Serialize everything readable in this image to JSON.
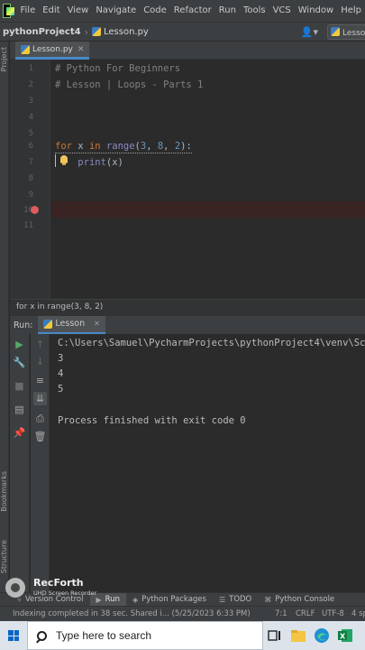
{
  "menubar": {
    "items": [
      "File",
      "Edit",
      "View",
      "Navigate",
      "Code",
      "Refactor",
      "Run",
      "Tools",
      "VCS",
      "Window",
      "Help"
    ]
  },
  "navbar": {
    "project": "pythonProject4",
    "file": "Lesson.py",
    "user_icon": "user-icon",
    "run_config": "Lesso"
  },
  "left_strip": {
    "project_label": "Project",
    "bookmarks_label": "Bookmarks",
    "structure_label": "Structure"
  },
  "editor": {
    "tab": "Lesson.py",
    "line_numbers": [
      "1",
      "2",
      "3",
      "4",
      "5",
      "6",
      "7",
      "8",
      "9",
      "10",
      "11"
    ],
    "line1": "# Python For Beginners",
    "line2": "# Lesson | Loops - Parts 1",
    "line6": {
      "kw_for": "for",
      "var": " x ",
      "kw_in": "in",
      "space": " ",
      "builtin": "range",
      "open": "(",
      "n1": "3",
      "c1": ", ",
      "n2": "8",
      "c2": ", ",
      "n3": "2",
      "close": "):"
    },
    "line7": {
      "indent": "    ",
      "builtin": "print",
      "args": "(x)"
    }
  },
  "breadcrumb": "for x in range(3, 8, 2)",
  "run_panel": {
    "title": "Run:",
    "tab": "Lesson",
    "console": [
      "C:\\Users\\Samuel\\PycharmProjects\\pythonProject4\\venv\\Sc",
      "3",
      "4",
      "5",
      "",
      "Process finished with exit code 0"
    ]
  },
  "bottom_tabs": [
    {
      "label": "Version Control",
      "icon": "branch-icon"
    },
    {
      "label": "Run",
      "icon": "run-icon"
    },
    {
      "label": "Python Packages",
      "icon": "packages-icon"
    },
    {
      "label": "TODO",
      "icon": "list-icon"
    },
    {
      "label": "Python Console",
      "icon": "console-icon"
    }
  ],
  "status": {
    "message": "Indexing completed in 38 sec. Shared i... (5/25/2023 6:33 PM)",
    "position": "7:1",
    "line_sep": "CRLF",
    "encoding": "UTF-8",
    "indent": "4 sp"
  },
  "watermark": {
    "title": "RecForth",
    "subtitle": "UHD Screen Recorder"
  },
  "taskbar": {
    "search_placeholder": "Type here to search"
  },
  "colors": {
    "background": "#2b2b2b",
    "keyword": "#cc7832",
    "number": "#6897bb",
    "builtin": "#8888c6",
    "comment": "#808080",
    "breakpoint": "#db5c5c",
    "run_green": "#59a869"
  }
}
